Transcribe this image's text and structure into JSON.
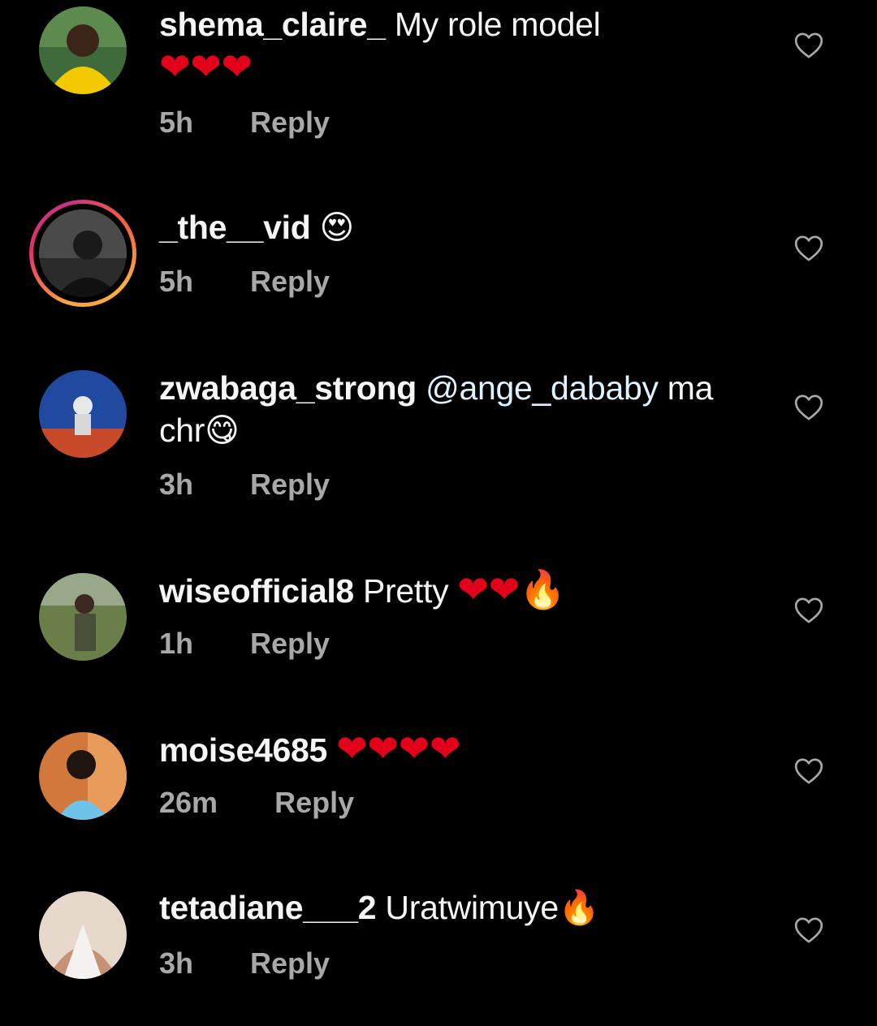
{
  "comments": [
    {
      "username": "shema_claire_",
      "text": "My role model",
      "emoji": "❤❤❤",
      "time": "5h",
      "reply_label": "Reply"
    },
    {
      "username": "_the__vid",
      "text": "",
      "emoji": "😍",
      "time": "5h",
      "reply_label": "Reply"
    },
    {
      "username": "zwabaga_strong",
      "mention": "@ange_dababy",
      "text": "ma chr",
      "emoji": "😋",
      "time": "3h",
      "reply_label": "Reply"
    },
    {
      "username": "wiseofficial8",
      "text": "Pretty",
      "emoji": "❤❤🔥",
      "time": "1h",
      "reply_label": "Reply"
    },
    {
      "username": "moise4685",
      "text": "",
      "emoji": "❤❤❤❤",
      "time": "26m",
      "reply_label": "Reply"
    },
    {
      "username": "tetadiane___2",
      "text": "Uratwimuye",
      "emoji": "🔥",
      "time": "3h",
      "reply_label": "Reply"
    }
  ],
  "icons": {
    "like": "heart-outline-icon"
  },
  "colors": {
    "background": "#000000",
    "primary_text": "#f5f5f5",
    "secondary_text": "#a8a8a8",
    "mention": "#e0f1ff",
    "heart_emoji": "#e3001b"
  }
}
